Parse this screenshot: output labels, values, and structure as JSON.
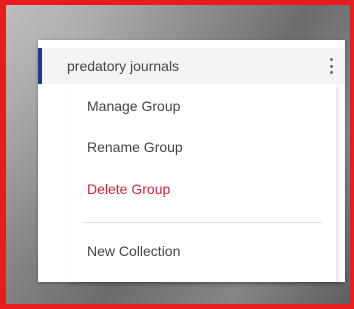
{
  "group": {
    "name": "predatory journals",
    "accent_color": "#1e3a8a",
    "menu_icon": "more-vertical-icon"
  },
  "menu": {
    "items": [
      {
        "label": "Manage Group"
      },
      {
        "label": "Rename Group"
      },
      {
        "label": "Delete Group",
        "color": "#c8283c"
      },
      {
        "label": "New Collection"
      }
    ]
  },
  "frame": {
    "border_color": "#e81c1c"
  }
}
